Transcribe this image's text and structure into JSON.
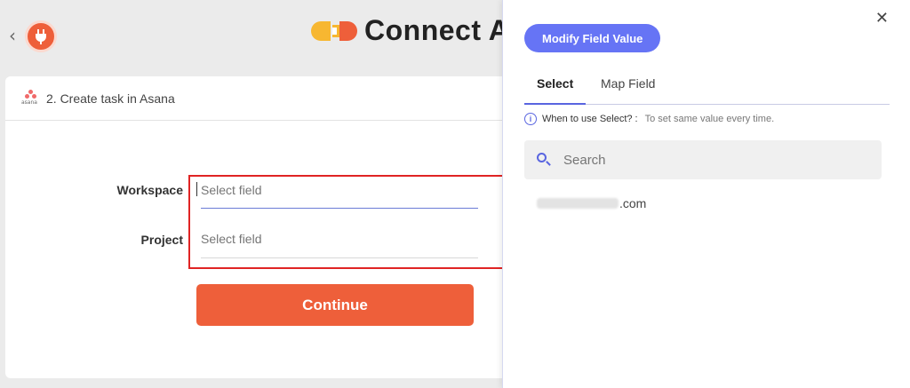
{
  "header": {
    "back_glyph": "‹",
    "app_icon": "plug-icon",
    "title": "Connect A"
  },
  "step": {
    "asana_word": "asana",
    "title": "2. Create task in Asana"
  },
  "form": {
    "workspace_label": "Workspace",
    "workspace_placeholder": "Select field",
    "project_label": "Project",
    "project_placeholder": "Select field",
    "continue_label": "Continue"
  },
  "panel": {
    "close_glyph": "✕",
    "modify_button": "Modify Field Value",
    "tabs": [
      {
        "label": "Select",
        "selected": true
      },
      {
        "label": "Map Field",
        "selected": false
      }
    ],
    "hint_icon": "i",
    "hint_question": "When to use Select? :",
    "hint_answer": "To set same value every time.",
    "search_placeholder": "Search",
    "options": [
      {
        "label_suffix": ".com"
      }
    ]
  },
  "colors": {
    "accent": "#ee5f3a",
    "primary": "#6674f5",
    "highlight_border": "#e02424"
  }
}
